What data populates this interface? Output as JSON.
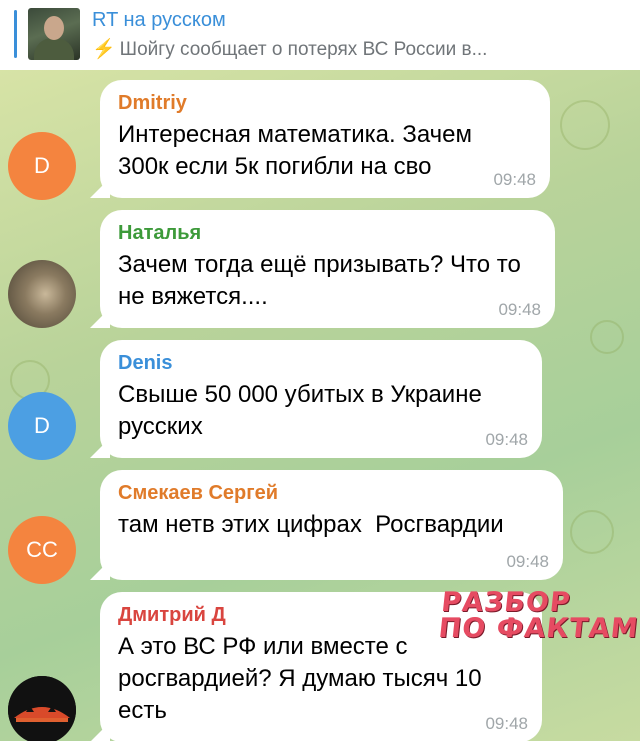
{
  "pinned": {
    "channel": "RT на русском",
    "preview": "Шойгу сообщает о потерях ВС России в...",
    "icon": "lightning-icon"
  },
  "messages": [
    {
      "author": "Dmitriy",
      "author_color": "#e07b2a",
      "avatar_letter": "D",
      "avatar_color": "#f4843f",
      "text": "Интересная математика. Зачем 300к если 5к погибли на сво",
      "time": "09:48"
    },
    {
      "author": "Наталья",
      "author_color": "#3d9a3a",
      "avatar_letter": "",
      "avatar_color": "#7a7260",
      "text": "Зачем тогда ещё призывать? Что то не вяжется....",
      "time": "09:48"
    },
    {
      "author": "Denis",
      "author_color": "#3a8fd9",
      "avatar_letter": "D",
      "avatar_color": "#4c9fe3",
      "text": "Свыше 50 000 убитых в Украине русских",
      "time": "09:48"
    },
    {
      "author": "Смекаев Сергей",
      "author_color": "#e07b2a",
      "avatar_letter": "CC",
      "avatar_color": "#f4843f",
      "text": "там нетв этих цифрах  Росгвардии",
      "time": "09:48"
    },
    {
      "author": "Дмитрий Д",
      "author_color": "#d9453f",
      "avatar_letter": "",
      "avatar_color": "#111111",
      "text": "А это ВС РФ или вместе с росгвардией? Я думаю тысяч 10 есть",
      "time": "09:48"
    }
  ],
  "watermark": {
    "line1": "РАЗБОР",
    "line2": "ПО ФАКТАМ"
  }
}
